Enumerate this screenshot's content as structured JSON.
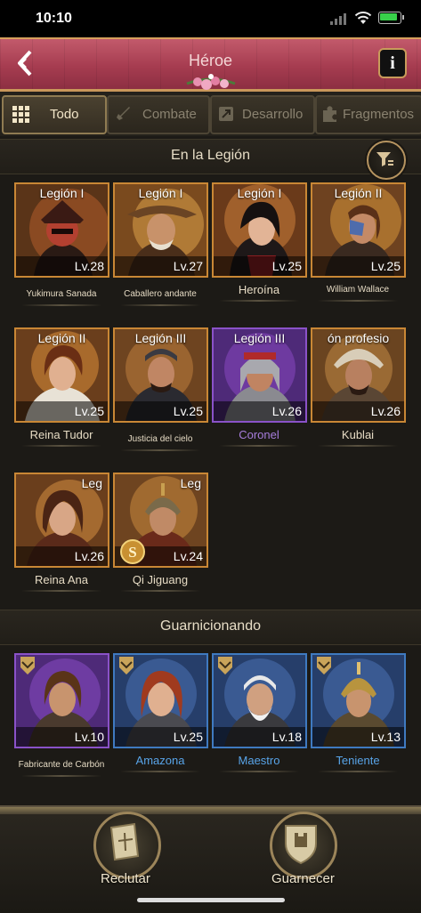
{
  "status_bar": {
    "time": "10:10"
  },
  "header": {
    "title": "Héroe",
    "back_icon": "back-arrow-icon",
    "info_label": "i"
  },
  "tabs": [
    {
      "label": "Todo",
      "icon": "grid-icon",
      "active": true
    },
    {
      "label": "Combate",
      "icon": "sword-icon",
      "active": false
    },
    {
      "label": "Desarrollo",
      "icon": "upgrade-icon",
      "active": false
    },
    {
      "label": "Fragmentos",
      "icon": "puzzle-icon",
      "active": false
    }
  ],
  "sections": {
    "legion": "En la Legión",
    "garrison": "Guarnicionando"
  },
  "legion_heroes": [
    {
      "legion": "Legión I",
      "level": "Lv.28",
      "name": "Yukimura Sanada"
    },
    {
      "legion": "Legión I",
      "level": "Lv.27",
      "name": "Caballero andante"
    },
    {
      "legion": "Legión I",
      "level": "Lv.25",
      "name": "Heroína"
    },
    {
      "legion": "Legión II",
      "level": "Lv.25",
      "name": "William Wallace"
    },
    {
      "legion": "Legión II",
      "level": "Lv.25",
      "name": "Reina Tudor"
    },
    {
      "legion": "Legión III",
      "level": "Lv.25",
      "name": "Justicia del cielo"
    },
    {
      "legion": "Legión III",
      "level": "Lv.26",
      "name": "Coronel"
    },
    {
      "legion": "ón profesio",
      "level": "Lv.26",
      "name": "Kublai"
    },
    {
      "legion": "Leg",
      "level": "Lv.26",
      "name": "Reina Ana"
    },
    {
      "legion": "Leg",
      "level": "Lv.24",
      "name": "Qi Jiguang"
    }
  ],
  "garrison_heroes": [
    {
      "level": "Lv.10",
      "name": "Fabricante de Carbón"
    },
    {
      "level": "Lv.25",
      "name": "Amazona"
    },
    {
      "level": "Lv.18",
      "name": "Maestro"
    },
    {
      "level": "Lv.13",
      "name": "Teniente"
    }
  ],
  "bottom_actions": {
    "recruit": "Reclutar",
    "garrison": "Guarnecer"
  },
  "colors": {
    "header": "#a63c50",
    "orange_border": "#c98735",
    "purple_border": "#8a52c8",
    "blue_border": "#3f7ac0"
  }
}
